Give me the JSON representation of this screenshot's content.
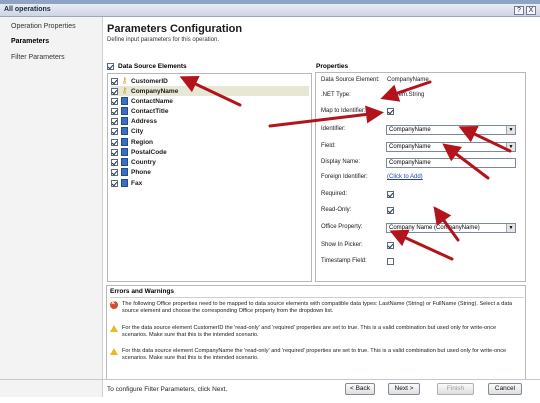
{
  "window": {
    "title": "All operations",
    "help_btn": "?",
    "close_btn": "X"
  },
  "nav": {
    "items": [
      {
        "label": "Operation Properties",
        "active": false
      },
      {
        "label": "Parameters",
        "active": true
      },
      {
        "label": "Filter Parameters",
        "active": false
      }
    ]
  },
  "header": {
    "title": "Parameters Configuration",
    "subtitle": "Define input parameters for this operation."
  },
  "data_source": {
    "header": "Data Source Elements",
    "checked": true,
    "items": [
      {
        "label": "CustomerID",
        "icon": "key-icon",
        "checked": true,
        "selected": false
      },
      {
        "label": "CompanyName",
        "icon": "key-icon",
        "checked": true,
        "selected": true
      },
      {
        "label": "ContactName",
        "icon": "field-icon",
        "checked": true,
        "selected": false
      },
      {
        "label": "ContactTitle",
        "icon": "field-icon",
        "checked": true,
        "selected": false
      },
      {
        "label": "Address",
        "icon": "field-icon",
        "checked": true,
        "selected": false
      },
      {
        "label": "City",
        "icon": "field-icon",
        "checked": true,
        "selected": false
      },
      {
        "label": "Region",
        "icon": "field-icon",
        "checked": true,
        "selected": false
      },
      {
        "label": "PostalCode",
        "icon": "field-icon",
        "checked": true,
        "selected": false
      },
      {
        "label": "Country",
        "icon": "field-icon",
        "checked": true,
        "selected": false
      },
      {
        "label": "Phone",
        "icon": "field-icon",
        "checked": true,
        "selected": false
      },
      {
        "label": "Fax",
        "icon": "field-icon",
        "checked": true,
        "selected": false
      }
    ]
  },
  "properties": {
    "header": "Properties",
    "data_source_element": {
      "label": "Data Source Element:",
      "value": "CompanyName"
    },
    "net_type": {
      "label": ".NET Type:",
      "value": "System.String"
    },
    "map_to_identifier": {
      "label": "Map to Identifier:",
      "checked": true
    },
    "identifier": {
      "label": "Identifier:",
      "value": "CompanyName"
    },
    "field": {
      "label": "Field:",
      "value": "CompanyName"
    },
    "display_name": {
      "label": "Display Name:",
      "value": "CompanyName"
    },
    "foreign_identifier": {
      "label": "Foreign Identifier:",
      "value": "(Click to Add)"
    },
    "required": {
      "label": "Required:",
      "checked": true
    },
    "read_only": {
      "label": "Read-Only:",
      "checked": true
    },
    "office_property": {
      "label": "Office Property:",
      "value": "Company Name (CompanyName)"
    },
    "show_in_picker": {
      "label": "Show In Picker:",
      "checked": true
    },
    "timestamp_field": {
      "label": "Timestamp Field:",
      "checked": false
    }
  },
  "errors": {
    "title": "Errors and Warnings",
    "messages": [
      {
        "type": "error",
        "text": "The following Office properties need to be mapped to data source elements with compatible data types: LastName (String) or FullName (String). Select a data source element and choose the corresponding Office property from the dropdown list."
      },
      {
        "type": "warning",
        "text": "For the data source element CustomerID the 'read-only' and 'required' properties are set to true. This is a valid combination but used only for write-once scenarios. Make sure that this is the intended scenario."
      },
      {
        "type": "warning",
        "text": "For this data source element CompanyName the 'read-only' and 'required' properties are set to true. This is a valid combination but used only for write-once scenarios. Make sure that this is the intended scenario."
      }
    ]
  },
  "footer": {
    "note": "To configure Filter Parameters, click Next.",
    "back": "< Back",
    "next": "Next >",
    "finish": "Finish",
    "cancel": "Cancel"
  },
  "colors": {
    "annotation_arrow": "#b3141b",
    "link": "#1a3fbb"
  }
}
